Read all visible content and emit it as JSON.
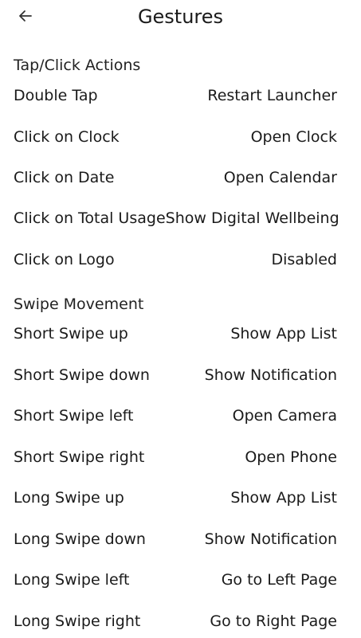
{
  "header": {
    "title": "Gestures",
    "back_icon": "arrow-left-icon"
  },
  "sections": {
    "tap": {
      "title": "Tap/Click Actions",
      "rows": [
        {
          "label": "Double Tap",
          "value": "Restart Launcher"
        },
        {
          "label": "Click on Clock",
          "value": "Open Clock"
        },
        {
          "label": "Click on Date",
          "value": "Open Calendar"
        },
        {
          "label": "Click on Total Usage",
          "value": "Show Digital Wellbeing"
        },
        {
          "label": "Click on Logo",
          "value": "Disabled"
        }
      ]
    },
    "swipe": {
      "title": "Swipe Movement",
      "rows": [
        {
          "label": "Short Swipe up",
          "value": "Show App List"
        },
        {
          "label": "Short Swipe down",
          "value": "Show Notification"
        },
        {
          "label": "Short Swipe left",
          "value": "Open Camera"
        },
        {
          "label": "Short Swipe right",
          "value": "Open Phone"
        },
        {
          "label": "Long Swipe up",
          "value": "Show App List"
        },
        {
          "label": "Long Swipe down",
          "value": "Show Notification"
        },
        {
          "label": "Long Swipe left",
          "value": "Go to Left Page"
        },
        {
          "label": "Long Swipe right",
          "value": "Go to Right Page"
        }
      ]
    }
  }
}
